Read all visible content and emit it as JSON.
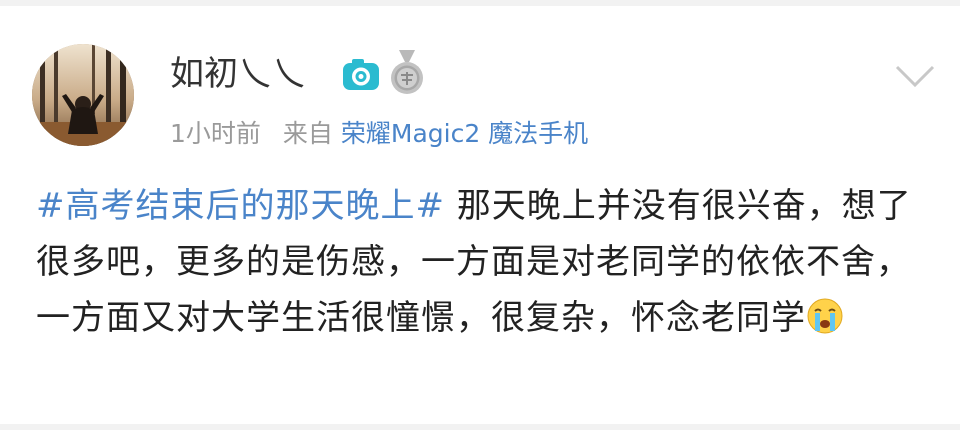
{
  "post": {
    "author": {
      "name": "如初乀乀",
      "avatar_icon": "avatar-photo",
      "badges": [
        "camera-icon",
        "medal-icon"
      ]
    },
    "time": "1小时前",
    "source_prefix": "来自",
    "source_link": "荣耀Magic2 魔法手机",
    "hashtag": "#高考结束后的那天晚上#",
    "text": " 那天晚上并没有很兴奋，想了很多吧，更多的是伤感，一方面是对老同学的依依不舍，一方面又对大学生活很憧憬，很复杂，怀念老同学",
    "trailing_emoji": "crying-emoji",
    "menu_icon": "chevron-down-icon"
  },
  "colors": {
    "link": "#4a84c9",
    "meta": "#9a9a9a",
    "text": "#222222",
    "camera_badge": "#2bbbd0",
    "medal_badge": "#a8a8a8"
  }
}
